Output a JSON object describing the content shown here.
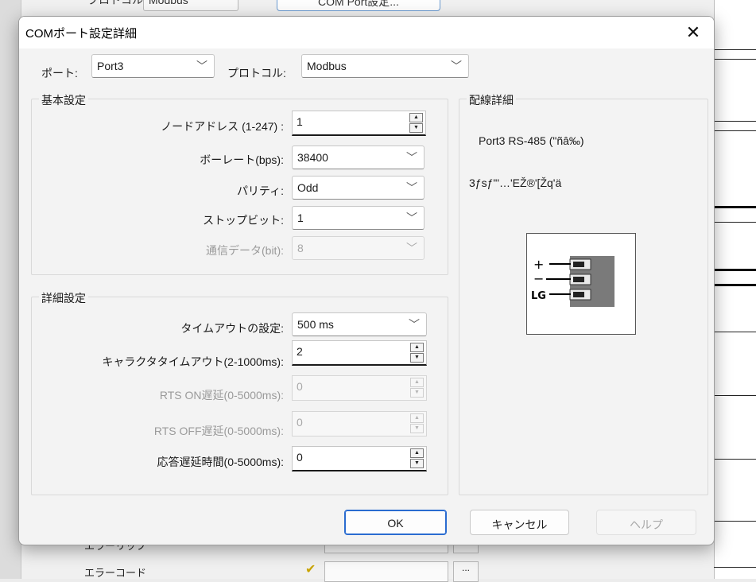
{
  "background": {
    "top_label": "ブロトコル:",
    "top_field_value": "Modbus",
    "top_button": "COM Port設定...",
    "rows": [
      {
        "label": "エラーリップ"
      },
      {
        "label": "エラーコード",
        "dots": "..."
      }
    ]
  },
  "dialog": {
    "title": "COMポート設定詳細",
    "close_glyph": "✕",
    "port_label": "ポート:",
    "port_value": "Port3",
    "protocol_label": "プロトコル:",
    "protocol_value": "Modbus",
    "basic_group_title": "基本設定",
    "basic": {
      "node_label": "ノードアドレス (1-247) :",
      "node_value": "1",
      "baud_label": "ボーレート(bps):",
      "baud_value": "38400",
      "parity_label": "パリティ:",
      "parity_value": "Odd",
      "stopbit_label": "ストップビット:",
      "stopbit_value": "1",
      "databits_label": "通信データ(bit):",
      "databits_value": "8"
    },
    "advanced_group_title": "詳細設定",
    "advanced": {
      "timeout_label": "タイムアウトの設定:",
      "timeout_value": "500 ms",
      "char_timeout_label": "キャラクタタイムアウト(2-1000ms):",
      "char_timeout_value": "2",
      "rts_on_label": "RTS ON遅延(0-5000ms):",
      "rts_on_value": "0",
      "rts_off_label": "RTS OFF遅延(0-5000ms):",
      "rts_off_value": "0",
      "resp_delay_label": "応答遅延時間(0-5000ms):",
      "resp_delay_value": "0"
    },
    "wiring_group_title": "配線詳細",
    "wiring": {
      "line1": "Port3 RS-485 (\"ñâ‰)",
      "line2": "3ƒsƒ\"'…'EŽ®'[Žq'ä",
      "plus": "+",
      "minus": "−",
      "lg": "LG"
    },
    "buttons": {
      "ok": "OK",
      "cancel": "キャンセル",
      "help": "ヘルプ"
    }
  }
}
